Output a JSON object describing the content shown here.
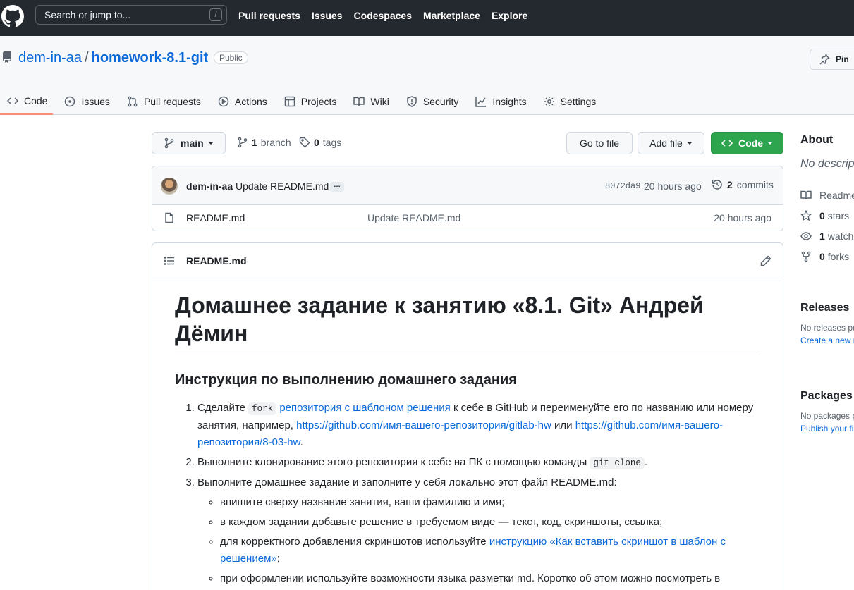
{
  "header": {
    "search_placeholder": "Search or jump to...",
    "search_shortcut": "/",
    "nav": [
      "Pull requests",
      "Issues",
      "Codespaces",
      "Marketplace",
      "Explore"
    ]
  },
  "repo": {
    "owner": "dem-in-aa",
    "separator": "/",
    "name": "homework-8.1-git",
    "visibility": "Public",
    "pin_label": "Pin",
    "tabs": [
      {
        "label": "Code",
        "icon": "code-icon",
        "active": true
      },
      {
        "label": "Issues",
        "icon": "issue-icon"
      },
      {
        "label": "Pull requests",
        "icon": "pull-request-icon"
      },
      {
        "label": "Actions",
        "icon": "play-icon"
      },
      {
        "label": "Projects",
        "icon": "table-icon"
      },
      {
        "label": "Wiki",
        "icon": "book-icon"
      },
      {
        "label": "Security",
        "icon": "shield-icon"
      },
      {
        "label": "Insights",
        "icon": "graph-icon"
      },
      {
        "label": "Settings",
        "icon": "gear-icon"
      }
    ]
  },
  "toolbar": {
    "branch": "main",
    "branch_count": "1",
    "branch_label": "branch",
    "tag_count": "0",
    "tag_label": "tags",
    "go_to_file": "Go to file",
    "add_file": "Add file",
    "code": "Code"
  },
  "commit": {
    "author": "dem-in-aa",
    "message": "Update README.md",
    "ellipsis": "…",
    "sha": "8072da9",
    "time": "20 hours ago",
    "commit_count": "2",
    "commit_label": "commits"
  },
  "files": [
    {
      "name": "README.md",
      "message": "Update README.md",
      "time": "20 hours ago"
    }
  ],
  "readme": {
    "file_title": "README.md",
    "h1": "Домашнее задание к занятию «8.1. Git» Андрей Дёмин",
    "h3": "Инструкция по выполнению домашнего задания",
    "step1_a": "Сделайте ",
    "step1_code": "fork",
    "step1_link": "репозитория с шаблоном решения",
    "step1_b": " к себе в GitHub и переименуйте его по названию или номеру занятия, например, ",
    "step1_url1": "https://github.com/имя-вашего-репозитория/gitlab-hw",
    "step1_or": " или ",
    "step1_url2": "https://github.com/имя-вашего-репозитория/8-03-hw",
    "step1_end": ".",
    "step2_a": "Выполните клонирование этого репозитория к себе на ПК с помощью команды ",
    "step2_code": "git clone",
    "step2_end": ".",
    "step3": "Выполните домашнее задание и заполните у себя локально этот файл README.md:",
    "bullet1": "впишите сверху название занятия, ваши фамилию и имя;",
    "bullet2": "в каждом задании добавьте решение в требуемом виде — текст, код, скриншоты, ссылка;",
    "bullet3_a": "для корректного добавления скриншотов используйте ",
    "bullet3_link": "инструкцию «Как вставить скриншот в шаблон с решением»",
    "bullet3_end": ";",
    "bullet4": "при оформлении используйте возможности языка разметки md. Коротко об этом можно посмотреть в"
  },
  "sidebar": {
    "about_title": "About",
    "description": "No descript",
    "readme": "Readme",
    "stars_count": "0",
    "stars_label": "stars",
    "watch_count": "1",
    "watch_label": "watchi",
    "forks_count": "0",
    "forks_label": "forks",
    "releases_title": "Releases",
    "releases_text": "No releases pu",
    "releases_link": "Create a new r",
    "packages_title": "Packages",
    "packages_text": "No packages p",
    "packages_link": "Publish your fi"
  },
  "colors": {
    "header_bg": "#24292f",
    "accent_link": "#0969da",
    "primary_button": "#2da44e",
    "active_tab_underline": "#fd8c73"
  }
}
